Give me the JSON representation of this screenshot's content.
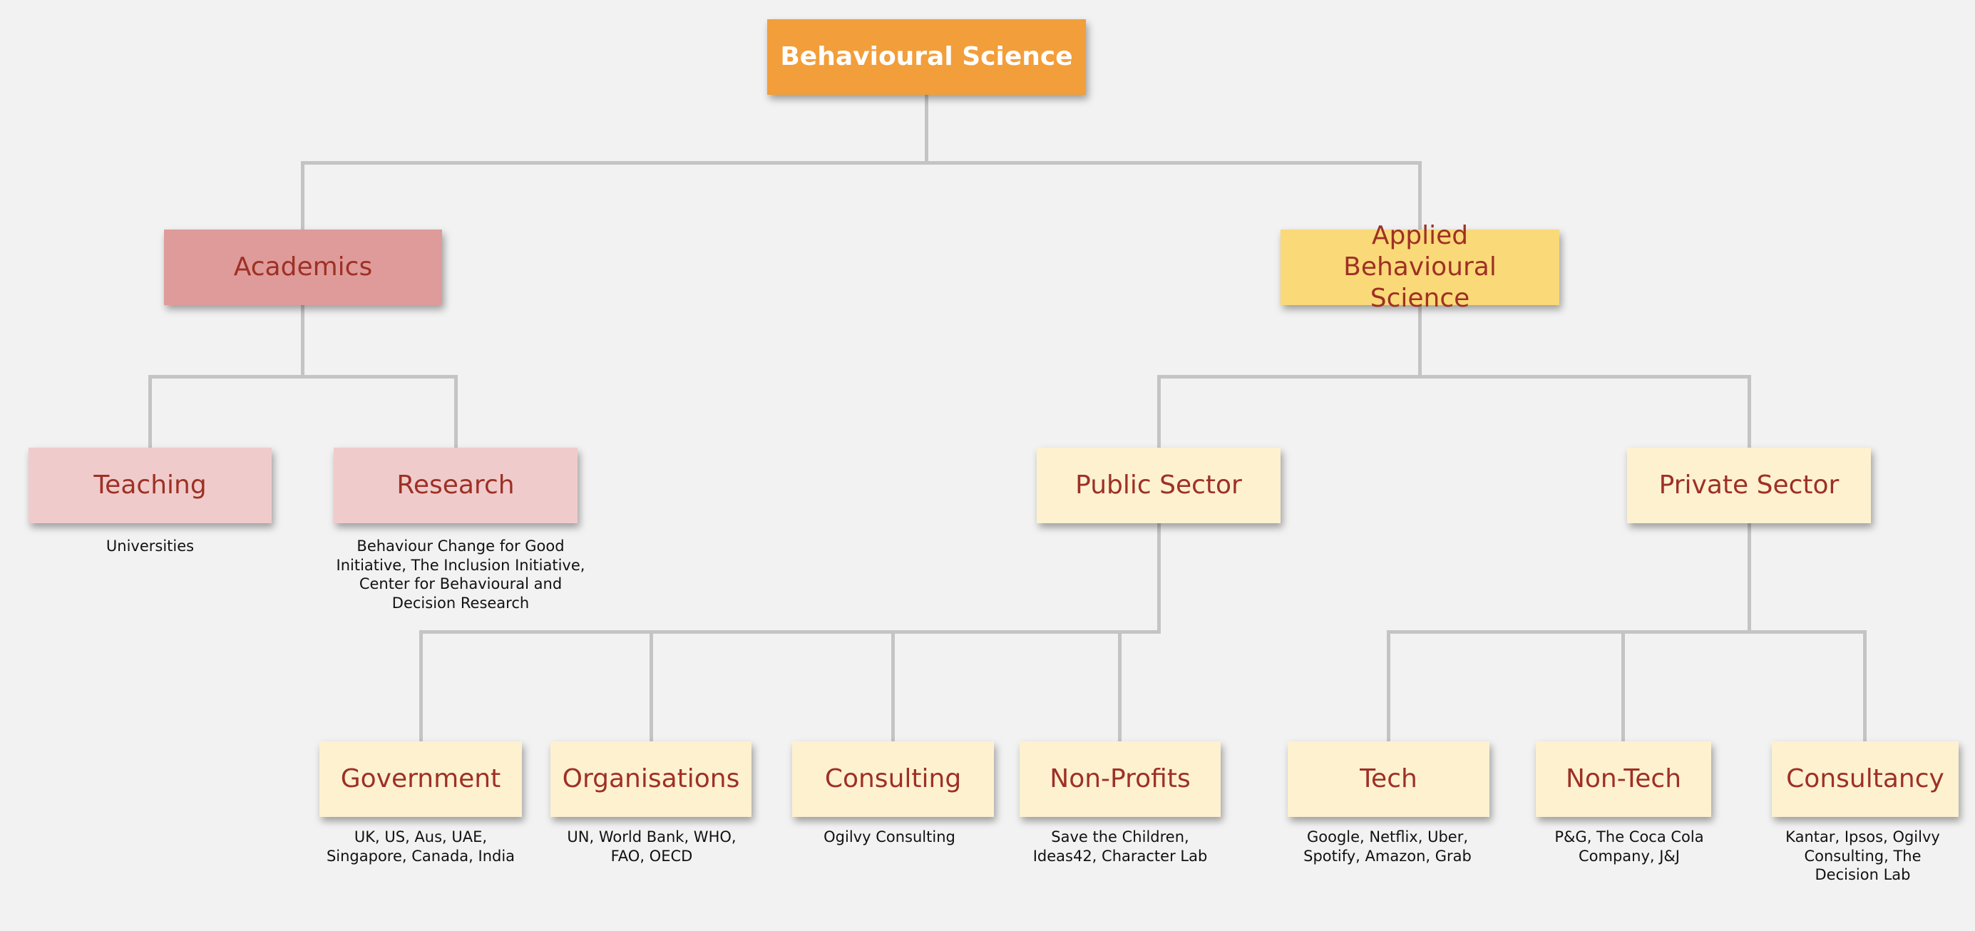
{
  "diagram": {
    "root": {
      "label": "Behavioural Science"
    },
    "academics": {
      "label": "Academics"
    },
    "applied": {
      "label": "Applied Behavioural Science"
    },
    "teaching": {
      "label": "Teaching",
      "caption": "Universities"
    },
    "research": {
      "label": "Research",
      "caption": "Behaviour Change for Good Initiative, The Inclusion Initiative, Center for Behavioural and Decision Research"
    },
    "public_sector": {
      "label": "Public Sector"
    },
    "private_sector": {
      "label": "Private Sector"
    },
    "government": {
      "label": "Government",
      "caption": "UK, US, Aus, UAE, Singapore, Canada, India"
    },
    "organisations": {
      "label": "Organisations",
      "caption": "UN, World Bank, WHO, FAO, OECD"
    },
    "consulting": {
      "label": "Consulting",
      "caption": "Ogilvy Consulting"
    },
    "non_profits": {
      "label": "Non-Profits",
      "caption": "Save the Children, Ideas42, Character Lab"
    },
    "tech": {
      "label": "Tech",
      "caption": "Google, Netflix, Uber, Spotify, Amazon, Grab"
    },
    "non_tech": {
      "label": "Non-Tech",
      "caption": "P&G, The Coca Cola Company, J&J"
    },
    "consultancy": {
      "label": "Consultancy",
      "caption": "Kantar, Ipsos, Ogilvy Consulting, The Decision Lab"
    }
  },
  "colors": {
    "root": "#f29e3a",
    "academics": "#de9b9a",
    "applied": "#fad978",
    "academic_children": "#efcccb",
    "applied_children": "#fdf1d0",
    "node_text": "#9e3025",
    "connector": "#c4c4c4",
    "background": "#f2f2f2"
  }
}
